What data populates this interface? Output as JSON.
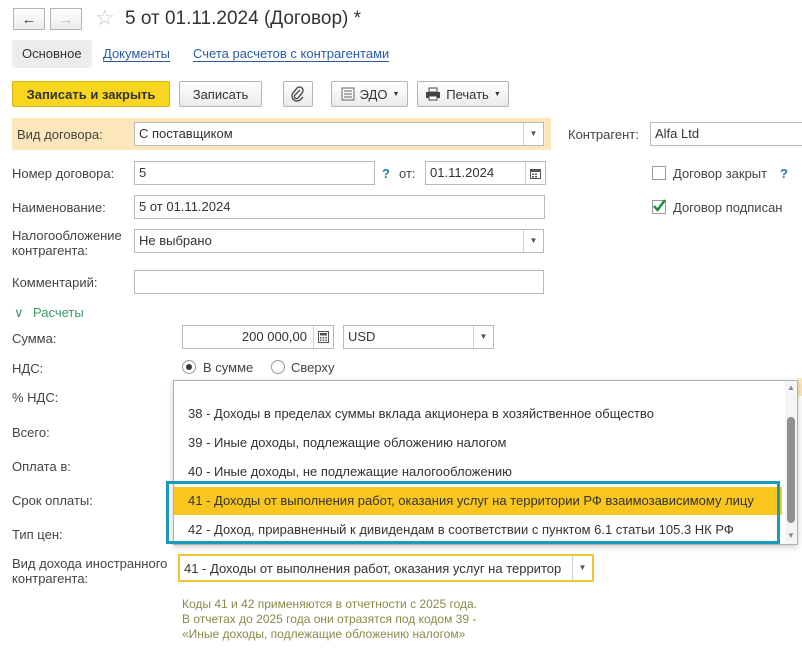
{
  "window": {
    "title": "5 от 01.11.2024 (Договор) *",
    "back_icon": "←",
    "forward_icon": "→",
    "star_icon": "☆"
  },
  "tabs": {
    "main": "Основное",
    "documents": "Документы",
    "accounts": "Счета расчетов с контрагентами"
  },
  "toolbar": {
    "save_close": "Записать и закрыть",
    "save": "Записать",
    "clip_icon": "📎",
    "edo": "ЭДО",
    "print": "Печать",
    "dd": "▼"
  },
  "form": {
    "contract_type_label": "Вид договора:",
    "contract_type_value": "С поставщиком",
    "counterparty_label": "Контрагент:",
    "counterparty_value": "Alfa Ltd",
    "number_label": "Номер договора:",
    "number_value": "5",
    "help": "?",
    "from_label": "от:",
    "date_value": "01.11.2024",
    "closed_label": "Договор закрыт",
    "name_label": "Наименование:",
    "name_value": "5 от 01.11.2024",
    "signed_label": "Договор подписан",
    "tax_label": "Налогообложение контрагента:",
    "tax_value": "Не выбрано",
    "comment_label": "Комментарий:"
  },
  "calc": {
    "section_label": "Расчеты",
    "chevron": "∨",
    "sum_label": "Сумма:",
    "sum_value": "200 000,00",
    "currency_value": "USD",
    "vat_label": "НДС:",
    "vat_in_sum": "В сумме",
    "vat_on_top": "Сверху",
    "vat_percent_label": "% НДС:",
    "total_label": "Всего:",
    "pay_in_label": "Оплата в:",
    "pay_term_label": "Срок оплаты:",
    "price_type_label": "Тип цен:",
    "income_type_label": "Вид дохода иностранного контрагента:",
    "income_type_value": "41 - Доходы от выполнения работ, оказания услуг на территор"
  },
  "dropdown": {
    "options": [
      "38 - Доходы в пределах суммы вклада акционера в хозяйственное общество",
      "39 - Иные доходы, подлежащие обложению налогом",
      "40 - Иные доходы, не подлежащие налогообложению",
      "41 - Доходы от выполнения работ, оказания услуг на территории РФ взаимозависимому лицу",
      "42 - Доход, приравненный к дивидендам в соответствии с пунктом 6.1 статьи 105.3 НК РФ"
    ],
    "selected_index": 3
  },
  "note": {
    "line1": "Коды 41 и 42 применяются в отчетности с 2025 года.",
    "line2": "В отчетах до 2025 года они отразятся под кодом 39 -",
    "line3": "«Иные доходы, подлежащие обложению налогом»"
  },
  "colors": {
    "accent_yellow": "#f8d51e",
    "highlight_box": "#1a9bb8",
    "focus_border": "#f0c43a",
    "link": "#2a5ba9"
  }
}
